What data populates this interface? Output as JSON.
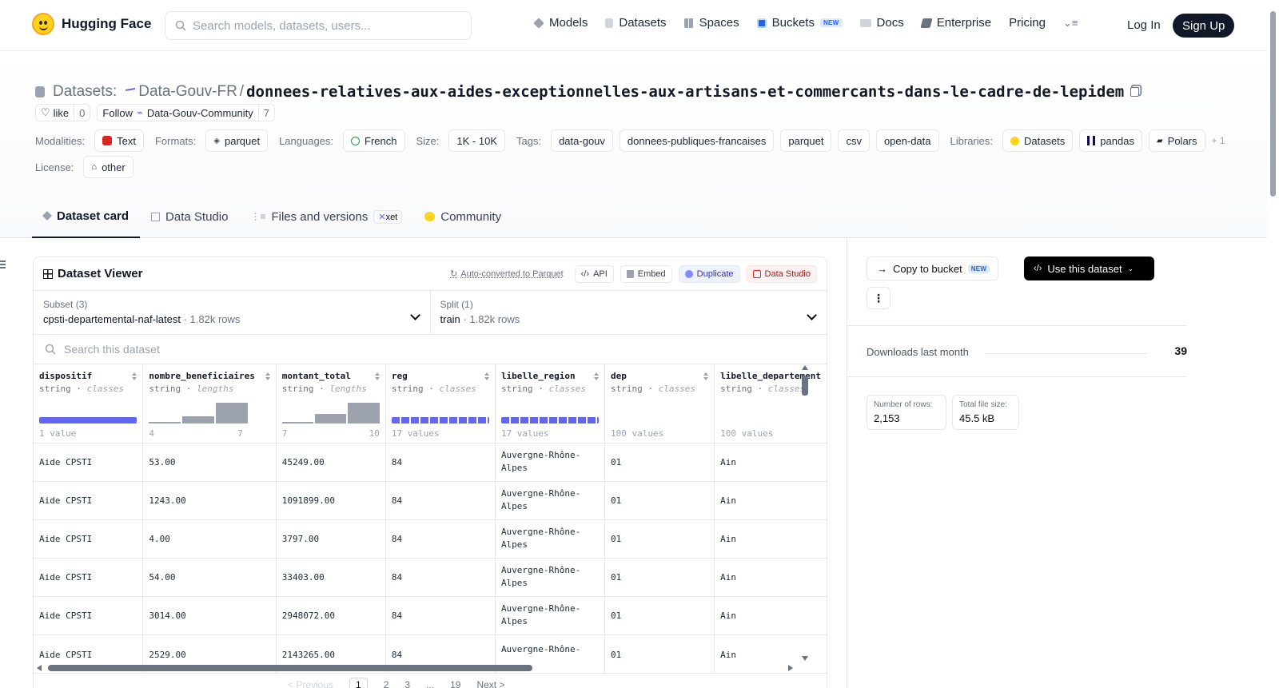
{
  "nav": {
    "brand": "Hugging Face",
    "search_placeholder": "Search models, datasets, users...",
    "links": [
      {
        "label": "Models",
        "icon": "cube-icon"
      },
      {
        "label": "Datasets",
        "icon": "database-icon"
      },
      {
        "label": "Spaces",
        "icon": "grid-icon"
      },
      {
        "label": "Buckets",
        "icon": "bucket-icon",
        "badge": "NEW"
      },
      {
        "label": "Docs",
        "icon": "book-icon"
      },
      {
        "label": "Enterprise",
        "icon": "enterprise-icon"
      },
      {
        "label": "Pricing"
      }
    ],
    "login": "Log In",
    "signup": "Sign Up"
  },
  "header": {
    "section": "Datasets:",
    "org": "Data-Gouv-FR",
    "separator": "/",
    "repo": "donnees-relatives-aux-aides-exceptionnelles-aux-artisans-et-commercants-dans-le-cadre-de-lepidem",
    "like_label": "like",
    "like_count": "0",
    "follow_label": "Follow",
    "follow_org": "Data-Gouv-Community",
    "follow_count": "7",
    "modalities_label": "Modalities:",
    "modality": "Text",
    "formats_label": "Formats:",
    "format": "parquet",
    "languages_label": "Languages:",
    "language": "French",
    "size_label": "Size:",
    "size": "1K - 10K",
    "tags_label": "Tags:",
    "tags": [
      "data-gouv",
      "donnees-publiques-francaises",
      "parquet",
      "csv",
      "open-data"
    ],
    "libraries_label": "Libraries:",
    "libraries": [
      "Datasets",
      "pandas",
      "Polars"
    ],
    "libraries_more": "+ 1",
    "license_label": "License:",
    "license": "other"
  },
  "tabs": [
    {
      "label": "Dataset card"
    },
    {
      "label": "Data Studio"
    },
    {
      "label": "Files and versions",
      "badge": "xet"
    },
    {
      "label": "Community"
    }
  ],
  "viewer": {
    "title": "Dataset Viewer",
    "auto_converted": "Auto-converted to Parquet",
    "api": "API",
    "embed": "Embed",
    "duplicate": "Duplicate",
    "data_studio": "Data Studio",
    "subset_label": "Subset (3)",
    "subset_value": "cpsti-departemental-naf-latest",
    "subset_rows": "1.82k rows",
    "split_label": "Split (1)",
    "split_value": "train",
    "split_rows": "1.82k rows",
    "search_placeholder": "Search this dataset",
    "columns": [
      {
        "name": "dispositif",
        "type": "string",
        "kind": "classes",
        "footer_left": "1 value",
        "footer_right": ""
      },
      {
        "name": "nombre_beneficiaires",
        "type": "string",
        "kind": "lengths",
        "footer_left": "4",
        "footer_right": "7"
      },
      {
        "name": "montant_total",
        "type": "string",
        "kind": "lengths",
        "footer_left": "7",
        "footer_right": "10"
      },
      {
        "name": "reg",
        "type": "string",
        "kind": "classes",
        "footer_left": "17 values",
        "footer_right": ""
      },
      {
        "name": "libelle_region",
        "type": "string",
        "kind": "classes",
        "footer_left": "17 values",
        "footer_right": ""
      },
      {
        "name": "dep",
        "type": "string",
        "kind": "classes",
        "footer_left": "100 values",
        "footer_right": ""
      },
      {
        "name": "libelle_departement",
        "type": "string",
        "kind": "classes",
        "footer_left": "100 values",
        "footer_right": ""
      }
    ],
    "rows": [
      [
        "Aide CPSTI",
        "53.00",
        "45249.00",
        "84",
        "Auvergne-Rhône-Alpes",
        "01",
        "Ain"
      ],
      [
        "Aide CPSTI",
        "1243.00",
        "1091899.00",
        "84",
        "Auvergne-Rhône-Alpes",
        "01",
        "Ain"
      ],
      [
        "Aide CPSTI",
        "4.00",
        "3797.00",
        "84",
        "Auvergne-Rhône-Alpes",
        "01",
        "Ain"
      ],
      [
        "Aide CPSTI",
        "54.00",
        "33403.00",
        "84",
        "Auvergne-Rhône-Alpes",
        "01",
        "Ain"
      ],
      [
        "Aide CPSTI",
        "3014.00",
        "2948072.00",
        "84",
        "Auvergne-Rhône-Alpes",
        "01",
        "Ain"
      ],
      [
        "Aide CPSTI",
        "2529.00",
        "2143265.00",
        "84",
        "Auvergne-Rhône-",
        "01",
        "Ain"
      ]
    ],
    "pager": {
      "prev": "< Previous",
      "pages": [
        "1",
        "2",
        "3",
        "...",
        "19"
      ],
      "current": "1",
      "next": "Next >"
    }
  },
  "sidebar": {
    "copy_to_bucket": "Copy to bucket",
    "new_badge": "NEW",
    "use_dataset": "Use this dataset",
    "downloads_label": "Downloads last month",
    "downloads_value": "39",
    "rows_label": "Number of rows:",
    "rows_value": "2,153",
    "size_label": "Total file size:",
    "size_value": "45.5 kB"
  },
  "colors": {
    "accent": "#6366f1",
    "hist": "#9ca3af",
    "dark": "#111827",
    "brand": "#FFD21E"
  }
}
